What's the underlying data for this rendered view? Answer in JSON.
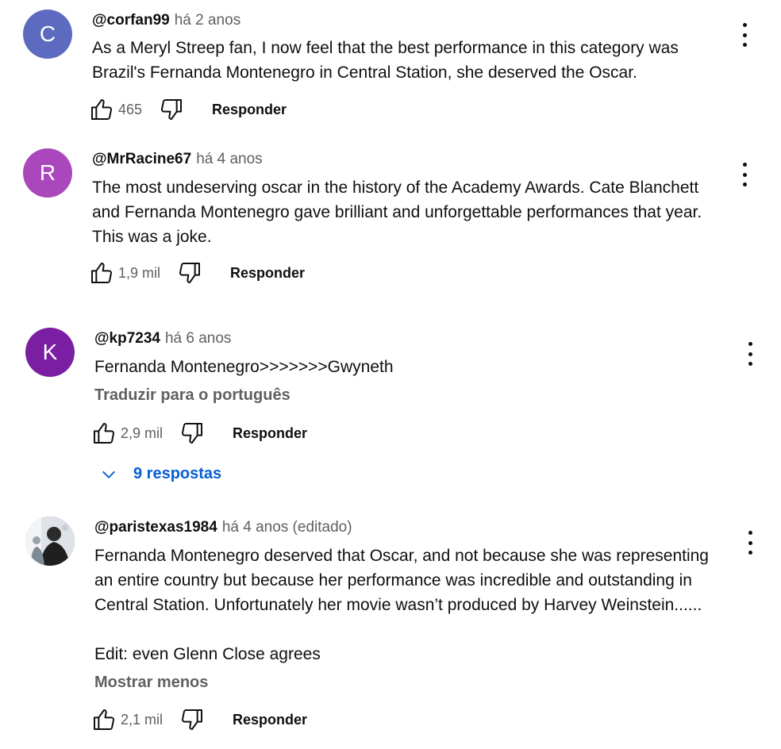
{
  "comments": [
    {
      "avatar_letter": "C",
      "avatar_color": "#5c6bc0",
      "author": "@corfan99",
      "time": "há 2 anos",
      "lines": [
        "As a Meryl Streep fan, I now feel that the best performance in this category was",
        "Brazil's  Fernanda Montenegro in Central Station, she deserved the Oscar."
      ],
      "likes": "465",
      "reply_label": "Responder"
    },
    {
      "avatar_letter": "R",
      "avatar_color": "#ab47bc",
      "author": "@MrRacine67",
      "time": "há 4 anos",
      "lines": [
        "The most undeserving oscar in the history of the Academy Awards. Cate Blanchett",
        "and Fernanda Montenegro gave brilliant and unforgettable performances that year.",
        "This was a joke."
      ],
      "likes": "1,9 mil",
      "reply_label": "Responder"
    },
    {
      "avatar_letter": "K",
      "avatar_color": "#7b1fa2",
      "author": "@kp7234",
      "time": "há 6 anos",
      "lines": [
        "Fernanda Montenegro>>>>>>>Gwyneth"
      ],
      "translate_label": "Traduzir para o português",
      "likes": "2,9 mil",
      "reply_label": "Responder",
      "replies_label": "9 respostas"
    },
    {
      "author": "@paristexas1984",
      "time": "há 4 anos (editado)",
      "lines": [
        "Fernanda Montenegro deserved that Oscar, and not because she was representing",
        "an entire country but because her performance was incredible and outstanding in",
        "Central Station. Unfortunately her movie wasn’t produced by Harvey Weinstein......",
        "",
        "Edit: even Glenn Close agrees"
      ],
      "show_less_label": "Mostrar menos",
      "likes": "2,1 mil",
      "reply_label": "Responder"
    }
  ],
  "colors": {
    "link_blue": "#065fd4",
    "secondary_text": "#606060"
  }
}
